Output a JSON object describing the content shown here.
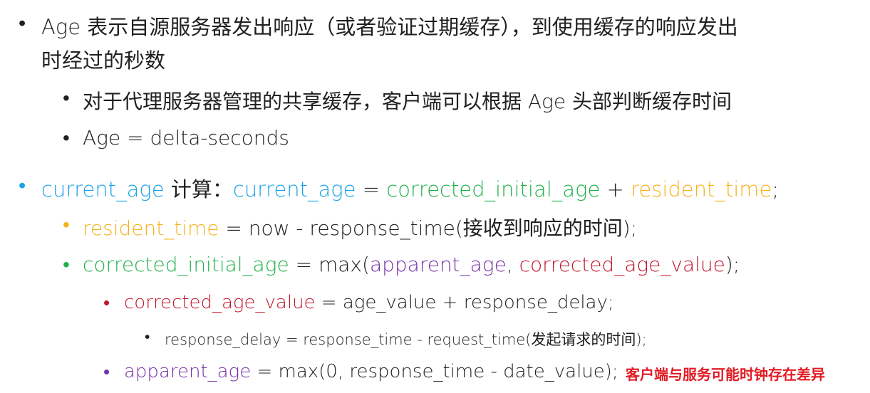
{
  "age_intro": {
    "line1": "Age 表示自源服务器发出响应（或者验证过期缓存），到使用缓存的响应发出",
    "line2": "时经过的秒数"
  },
  "shared_cache": "对于代理服务器管理的共享缓存，客户端可以根据 Age 头部判断缓存时间",
  "age_formula": "Age = delta-seconds",
  "current_age": {
    "term": "current_age",
    "label": " 计算：",
    "lhs": "current_age",
    "eq": " = ",
    "a": "corrected_initial_age",
    "plus": " + ",
    "b": "resident_time",
    "end": ";"
  },
  "resident_time": {
    "term": "resident_time",
    "rest": " = now - response_time(接收到响应的时间);"
  },
  "corrected_initial_age": {
    "term": "corrected_initial_age",
    "mid": " = max(",
    "a": "apparent_age",
    "comma": ", ",
    "b": "corrected_age_value",
    "end": ");"
  },
  "corrected_age_value": {
    "term": "corrected_age_value",
    "rest": " = age_value + response_delay;"
  },
  "response_delay": "response_delay = response_time - request_time(发起请求的时间);",
  "apparent_age": {
    "term": "apparent_age",
    "rest": " = max(0, response_time - date_value);"
  },
  "note": "客户端与服务可能时钟存在差异",
  "colors": {
    "blue": "#1aa3e8",
    "green": "#21b14c",
    "orange": "#f6b21b",
    "red": "#c2162b",
    "purple": "#7431a6",
    "note": "#e11b25"
  }
}
